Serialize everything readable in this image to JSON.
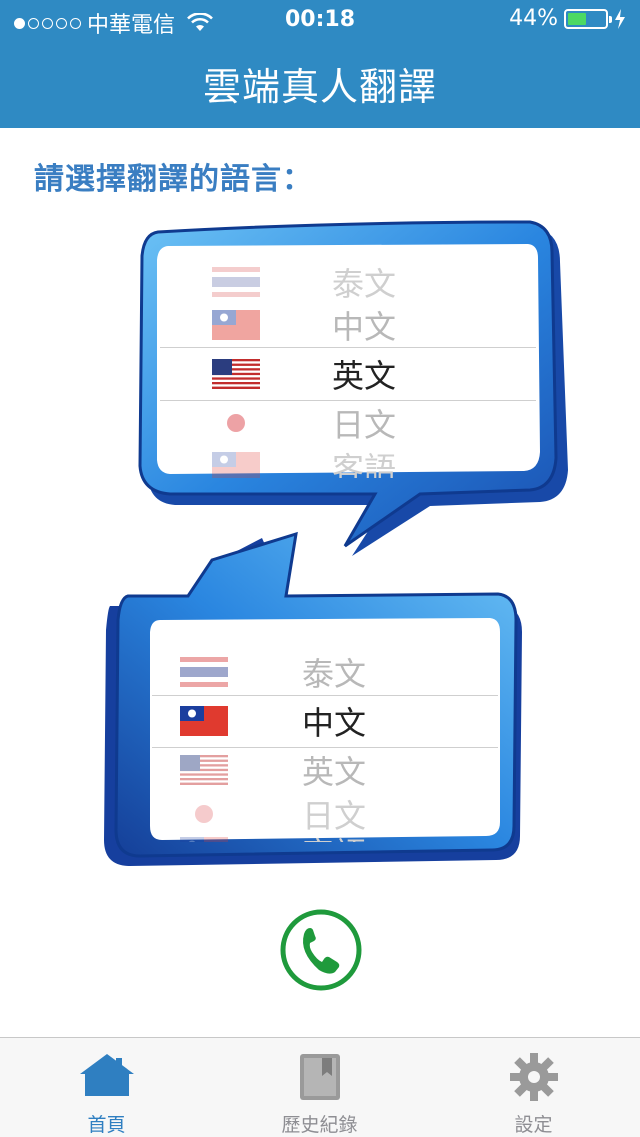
{
  "status_bar": {
    "carrier": "中華電信",
    "time": "00:18",
    "battery": "44%",
    "signal_bars_filled": 1,
    "battery_level": 0.44
  },
  "header": {
    "title": "雲端真人翻譯"
  },
  "prompt": "請選擇翻譯的語言：",
  "source_picker": {
    "items": [
      {
        "label": "泰文",
        "flag": "thailand-flag"
      },
      {
        "label": "中文",
        "flag": "taiwan-flag"
      },
      {
        "label": "英文",
        "flag": "usa-flag"
      },
      {
        "label": "日文",
        "flag": "japan-flag"
      },
      {
        "label": "客語",
        "flag": "taiwan-flag"
      }
    ],
    "selected": "英文"
  },
  "target_picker": {
    "items": [
      {
        "label": "泰文",
        "flag": "thailand-flag"
      },
      {
        "label": "中文",
        "flag": "taiwan-flag"
      },
      {
        "label": "英文",
        "flag": "usa-flag"
      },
      {
        "label": "日文",
        "flag": "japan-flag"
      },
      {
        "label": "客語",
        "flag": "taiwan-flag"
      }
    ],
    "selected": "中文"
  },
  "call_button": {
    "icon": "phone-icon"
  },
  "tabs": [
    {
      "label": "首頁",
      "icon": "home-icon",
      "active": true
    },
    {
      "label": "歷史紀錄",
      "icon": "book-icon",
      "active": false
    },
    {
      "label": "設定",
      "icon": "gear-icon",
      "active": false
    }
  ],
  "colors": {
    "header": "#2f8ac3",
    "accent": "#3a7ec2",
    "bubble": "#2b7bd6",
    "call_green": "#1f9a3c"
  }
}
